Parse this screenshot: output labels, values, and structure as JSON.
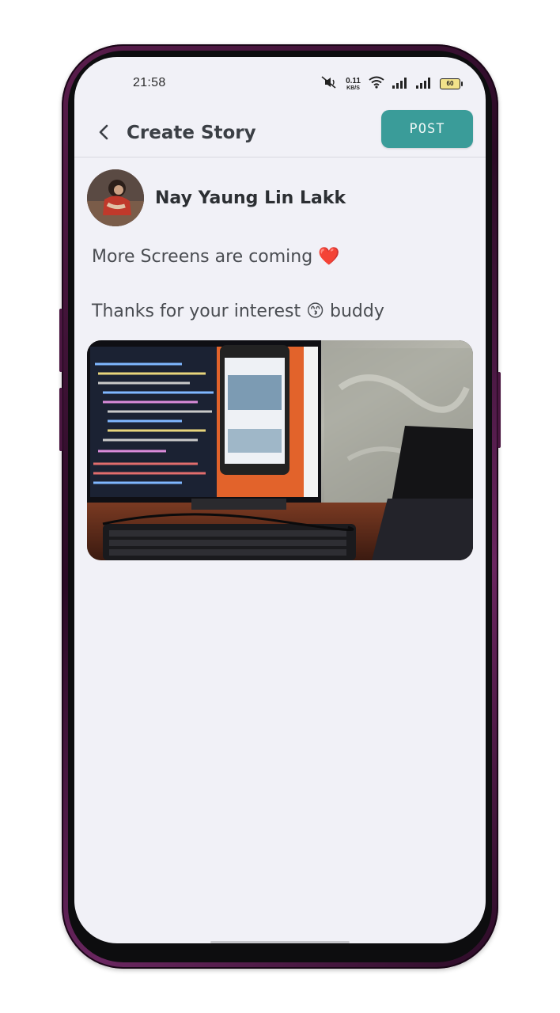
{
  "status_bar": {
    "time": "21:58",
    "net_speed_value": "0.11",
    "net_speed_unit": "KB/S",
    "battery": "60"
  },
  "app_bar": {
    "title": "Create Story",
    "post_label": "POST"
  },
  "author": {
    "name": "Nay Yaung Lin Lakk"
  },
  "story": {
    "line1": "More Screens are coming ❤️",
    "line2": "Thanks for your interest 😙 buddy"
  },
  "colors": {
    "accent": "#3a9c99",
    "screen_bg": "#f1f1f7",
    "frame": "#5b1d4d"
  },
  "icons": [
    "back-arrow-icon",
    "mute-icon",
    "wifi-icon",
    "signal-icon",
    "battery-icon"
  ]
}
